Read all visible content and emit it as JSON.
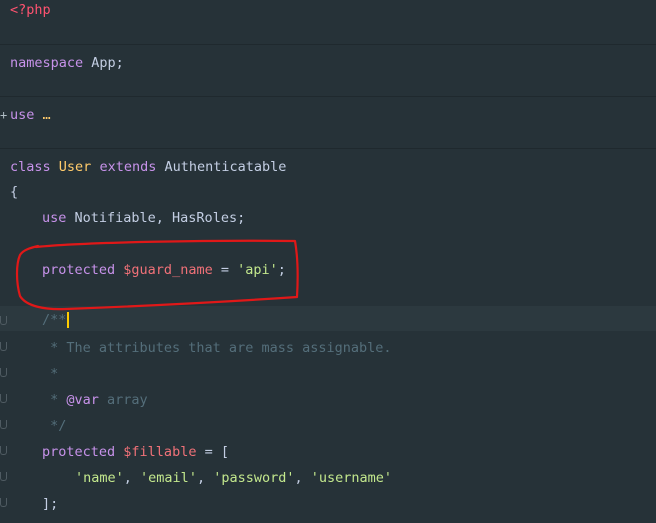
{
  "lines": {
    "php_open": "<?php",
    "namespace_kw": "namespace",
    "namespace_name": " App;",
    "use_kw": "use",
    "use_dots": " …",
    "class_kw": "class",
    "class_name": "User",
    "extends_kw": "extends",
    "parent_class": "Authenticatable",
    "open_brace": "{",
    "use_traits_kw": "use",
    "use_traits": " Notifiable, HasRoles;",
    "guard_protected": "protected",
    "guard_var": "$guard_name",
    "guard_eq": " = ",
    "guard_val": "'api'",
    "guard_semi": ";",
    "doc_open": "/**",
    "doc_line1": " * The attributes that are mass assignable.",
    "doc_line2": " *",
    "doc_line3_star": " * ",
    "doc_line3_tag": "@var",
    "doc_line3_type": " array",
    "doc_close": " */",
    "fillable_protected": "protected",
    "fillable_var": "$fillable",
    "fillable_eq": " = [",
    "fill_1": "'name'",
    "fill_2": "'email'",
    "fill_3": "'password'",
    "fill_4": "'username'",
    "comma_sep": ", ",
    "array_close": "];"
  },
  "colors": {
    "background": "#263238",
    "keyword": "#c792ea",
    "class_name": "#ffcb6b",
    "variable": "#f07178",
    "string": "#c3e88d",
    "comment": "#546e7a",
    "annotation": "#e01818"
  }
}
